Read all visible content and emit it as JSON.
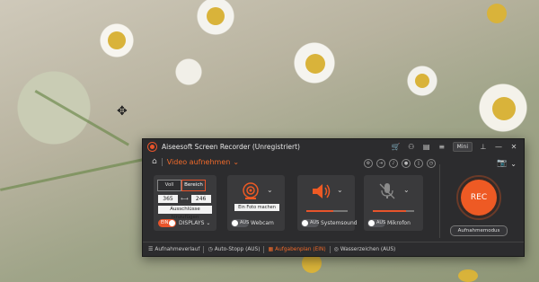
{
  "window": {
    "title": "Aiseesoft Screen Recorder (Unregistriert)",
    "mini_label": "Mini"
  },
  "modebar": {
    "mode_title": "Video aufnehmen"
  },
  "display_panel": {
    "seg_full": "Voll",
    "seg_region": "Bereich",
    "width": "365",
    "height": "246",
    "exclusions": "Ausschlüsse hinzufügen",
    "toggle_state": "EIN",
    "displays_label": "DISPLAYS"
  },
  "webcam_panel": {
    "photo_button": "Ein Foto machen",
    "toggle_state": "AUS",
    "label": "Webcam"
  },
  "system_panel": {
    "toggle_state": "AUS",
    "label": "Systemsound",
    "volume": 0.65
  },
  "mic_panel": {
    "toggle_state": "AUS",
    "label": "Mikrofon",
    "volume": 0.8
  },
  "record": {
    "rec_label": "REC",
    "mode_button": "Aufnahmemodus"
  },
  "footer": {
    "history": "Aufnahmeverlauf",
    "autostop": "Auto-Stopp (AUS)",
    "schedule": "Aufgabenplan (EIN)",
    "watermark": "Wasserzeichen (AUS)"
  },
  "colors": {
    "accent": "#ee5a24",
    "panel": "#3a3a3c",
    "window": "#2c2c2e"
  }
}
